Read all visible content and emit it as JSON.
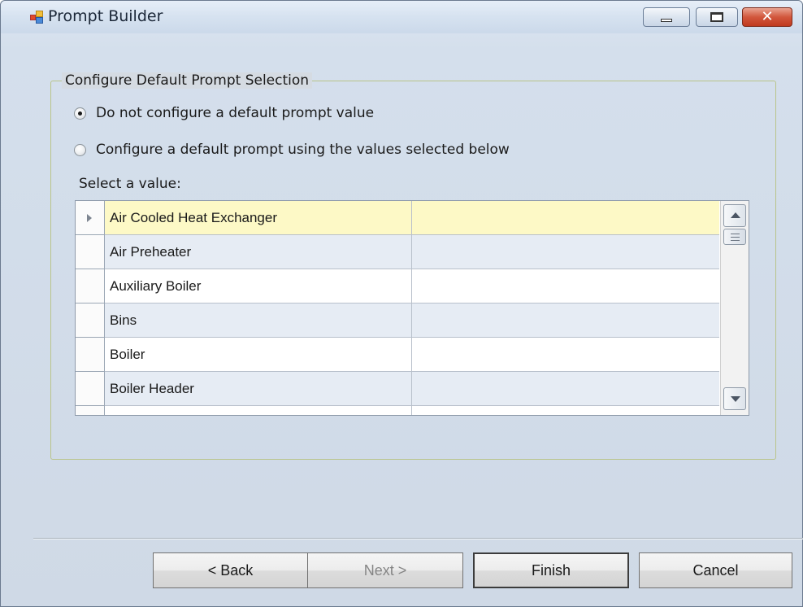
{
  "window": {
    "title": "Prompt Builder",
    "controls": {
      "minimize": "minimize",
      "maximize": "maximize",
      "close": "close"
    }
  },
  "group": {
    "title": "Configure Default Prompt Selection",
    "options": [
      {
        "label": "Do not configure a default prompt value",
        "checked": true
      },
      {
        "label": "Configure a default prompt using the values selected below",
        "checked": false
      }
    ],
    "select_label": "Select a value:"
  },
  "grid": {
    "rows": [
      {
        "name": "Air Cooled Heat Exchanger",
        "value": "",
        "selected": true
      },
      {
        "name": "Air Preheater",
        "value": "",
        "selected": false
      },
      {
        "name": "Auxiliary Boiler",
        "value": "",
        "selected": false
      },
      {
        "name": "Bins",
        "value": "",
        "selected": false
      },
      {
        "name": "Boiler",
        "value": "",
        "selected": false
      },
      {
        "name": "Boiler Header",
        "value": "",
        "selected": false
      }
    ]
  },
  "buttons": {
    "back": "< Back",
    "next": "Next >",
    "finish": "Finish",
    "cancel": "Cancel",
    "next_enabled": false
  },
  "colors": {
    "selected_row": "#fdf9c6",
    "alt_row": "#e6ecf4",
    "groupbox_border": "#b9c48a",
    "close_button": "#c03a1f"
  },
  "icons": {
    "app": "prompt-builder-app-icon",
    "row_indicator": "row-pointer-arrow-icon"
  }
}
